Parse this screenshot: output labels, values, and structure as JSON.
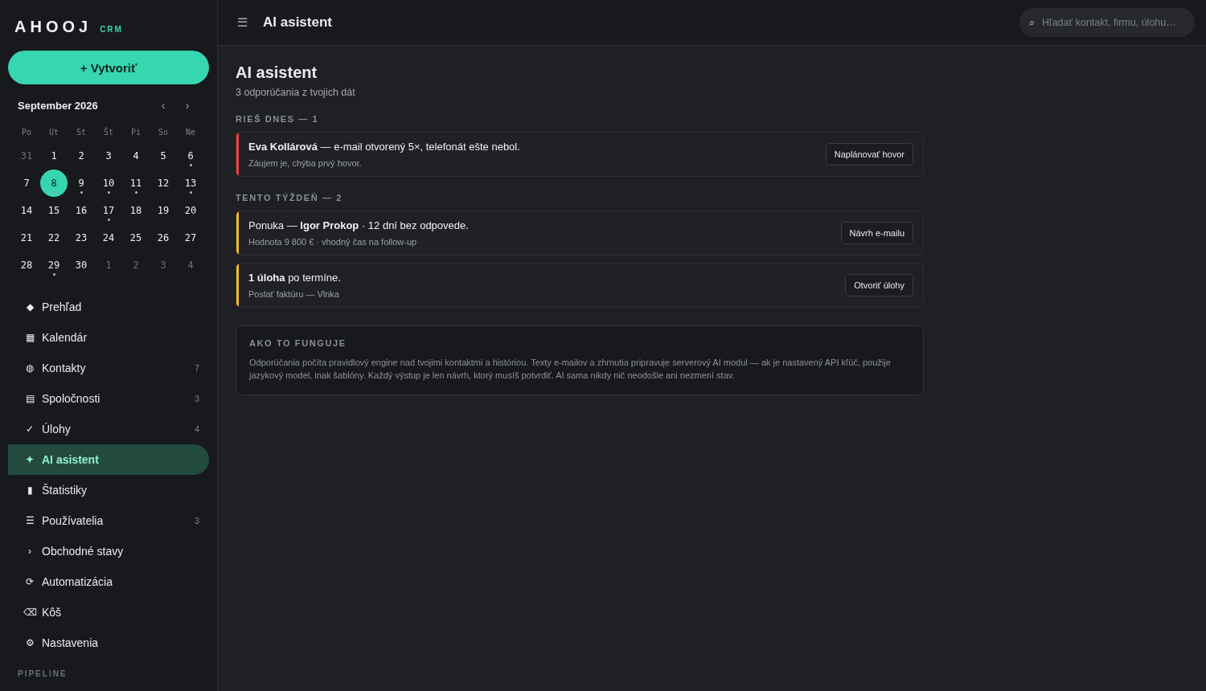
{
  "brand": {
    "name": "AHOOJ",
    "tag": "CRM"
  },
  "create_button": {
    "icon": "+",
    "label": "Vytvoriť"
  },
  "calendar": {
    "title": "September 2026",
    "prev": "‹",
    "next": "›",
    "weekdays": [
      "Po",
      "Ut",
      "St",
      "Št",
      "Pi",
      "So",
      "Ne"
    ],
    "days": [
      {
        "day": "31",
        "muted": true,
        "selected": false,
        "event": false
      },
      {
        "day": "1",
        "muted": false,
        "selected": false,
        "event": false
      },
      {
        "day": "2",
        "muted": false,
        "selected": false,
        "event": false
      },
      {
        "day": "3",
        "muted": false,
        "selected": false,
        "event": false
      },
      {
        "day": "4",
        "muted": false,
        "selected": false,
        "event": false
      },
      {
        "day": "5",
        "muted": false,
        "selected": false,
        "event": false
      },
      {
        "day": "6",
        "muted": false,
        "selected": false,
        "event": true
      },
      {
        "day": "7",
        "muted": false,
        "selected": false,
        "event": false
      },
      {
        "day": "8",
        "muted": false,
        "selected": true,
        "event": true
      },
      {
        "day": "9",
        "muted": false,
        "selected": false,
        "event": true
      },
      {
        "day": "10",
        "muted": false,
        "selected": false,
        "event": true
      },
      {
        "day": "11",
        "muted": false,
        "selected": false,
        "event": true
      },
      {
        "day": "12",
        "muted": false,
        "selected": false,
        "event": false
      },
      {
        "day": "13",
        "muted": false,
        "selected": false,
        "event": true
      },
      {
        "day": "14",
        "muted": false,
        "selected": false,
        "event": false
      },
      {
        "day": "15",
        "muted": false,
        "selected": false,
        "event": false
      },
      {
        "day": "16",
        "muted": false,
        "selected": false,
        "event": false
      },
      {
        "day": "17",
        "muted": false,
        "selected": false,
        "event": true
      },
      {
        "day": "18",
        "muted": false,
        "selected": false,
        "event": false
      },
      {
        "day": "19",
        "muted": false,
        "selected": false,
        "event": false
      },
      {
        "day": "20",
        "muted": false,
        "selected": false,
        "event": false
      },
      {
        "day": "21",
        "muted": false,
        "selected": false,
        "event": false
      },
      {
        "day": "22",
        "muted": false,
        "selected": false,
        "event": false
      },
      {
        "day": "23",
        "muted": false,
        "selected": false,
        "event": false
      },
      {
        "day": "24",
        "muted": false,
        "selected": false,
        "event": false
      },
      {
        "day": "25",
        "muted": false,
        "selected": false,
        "event": false
      },
      {
        "day": "26",
        "muted": false,
        "selected": false,
        "event": false
      },
      {
        "day": "27",
        "muted": false,
        "selected": false,
        "event": false
      },
      {
        "day": "28",
        "muted": false,
        "selected": false,
        "event": false
      },
      {
        "day": "29",
        "muted": false,
        "selected": false,
        "event": true
      },
      {
        "day": "30",
        "muted": false,
        "selected": false,
        "event": false
      },
      {
        "day": "1",
        "muted": true,
        "selected": false,
        "event": false
      },
      {
        "day": "2",
        "muted": true,
        "selected": false,
        "event": false
      },
      {
        "day": "3",
        "muted": true,
        "selected": false,
        "event": false
      },
      {
        "day": "4",
        "muted": true,
        "selected": false,
        "event": false
      }
    ]
  },
  "nav": [
    {
      "icon": "◆",
      "label": "Prehľad",
      "selected": false
    },
    {
      "icon": "▦",
      "label": "Kalendár",
      "selected": false
    },
    {
      "icon": "◍",
      "label": "Kontakty",
      "count": "7",
      "selected": false
    },
    {
      "icon": "▤",
      "label": "Spoločnosti",
      "count": "3",
      "selected": false
    },
    {
      "icon": "✓",
      "label": "Úlohy",
      "count": "4",
      "selected": false
    },
    {
      "icon": "✦",
      "label": "AI asistent",
      "selected": true
    },
    {
      "icon": "▮",
      "label": "Štatistiky",
      "selected": false
    },
    {
      "icon": "☰",
      "label": "Používatelia",
      "count": "3",
      "selected": false
    },
    {
      "icon": "›",
      "label": "Obchodné stavy",
      "selected": false
    },
    {
      "icon": "⟳",
      "label": "Automatizácia",
      "selected": false
    },
    {
      "icon": "⌫",
      "label": "Kôš",
      "selected": false
    },
    {
      "icon": "⚙",
      "label": "Nastavenia",
      "selected": false
    }
  ],
  "nav_section": "PIPELINE",
  "header": {
    "menu": "☰",
    "title": "AI asistent",
    "search": {
      "icon": "⌕",
      "placeholder": "Hľadať kontakt, firmu, úlohu…"
    }
  },
  "page": {
    "title": "AI asistent",
    "subtitle": "3 odporúčania z tvojich dát"
  },
  "groups": [
    {
      "title": "RIEŠ DNES — 1",
      "items": [
        {
          "color": "#ef4444",
          "text": "**Eva Kollárová** — e-mail otvorený 5×, telefonát ešte nebol.",
          "detail": "Záujem je, chýba prvý hovor.",
          "action": "Naplánovať hovor"
        }
      ]
    },
    {
      "title": "TENTO TÝŽDEŇ — 2",
      "items": [
        {
          "color": "#f5b82e",
          "text": "Ponuka — **Igor Prokop** · 12 dní bez odpovede.",
          "detail": "Hodnota 9 800 € · vhodný čas na follow-up",
          "action": "Návrh e-mailu"
        },
        {
          "color": "#f5b82e",
          "text": "**1 úloha** po termíne.",
          "detail": "Poslať faktúru — Vlnka",
          "action": "Otvoriť úlohy"
        }
      ]
    }
  ],
  "info": {
    "title": "AKO TO FUNGUJE",
    "text": "Odporúčania počíta pravidlový engine nad tvojimi kontaktmi a históriou. Texty e-mailov a zhrnutia pripravuje serverový AI modul — ak je nastavený API kľúč, použije jazykový model, inak šablóny. Každý výstup je len návrh, ktorý musíš potvrdiť. AI sama nikdy nič neodošle ani nezmení stav."
  }
}
